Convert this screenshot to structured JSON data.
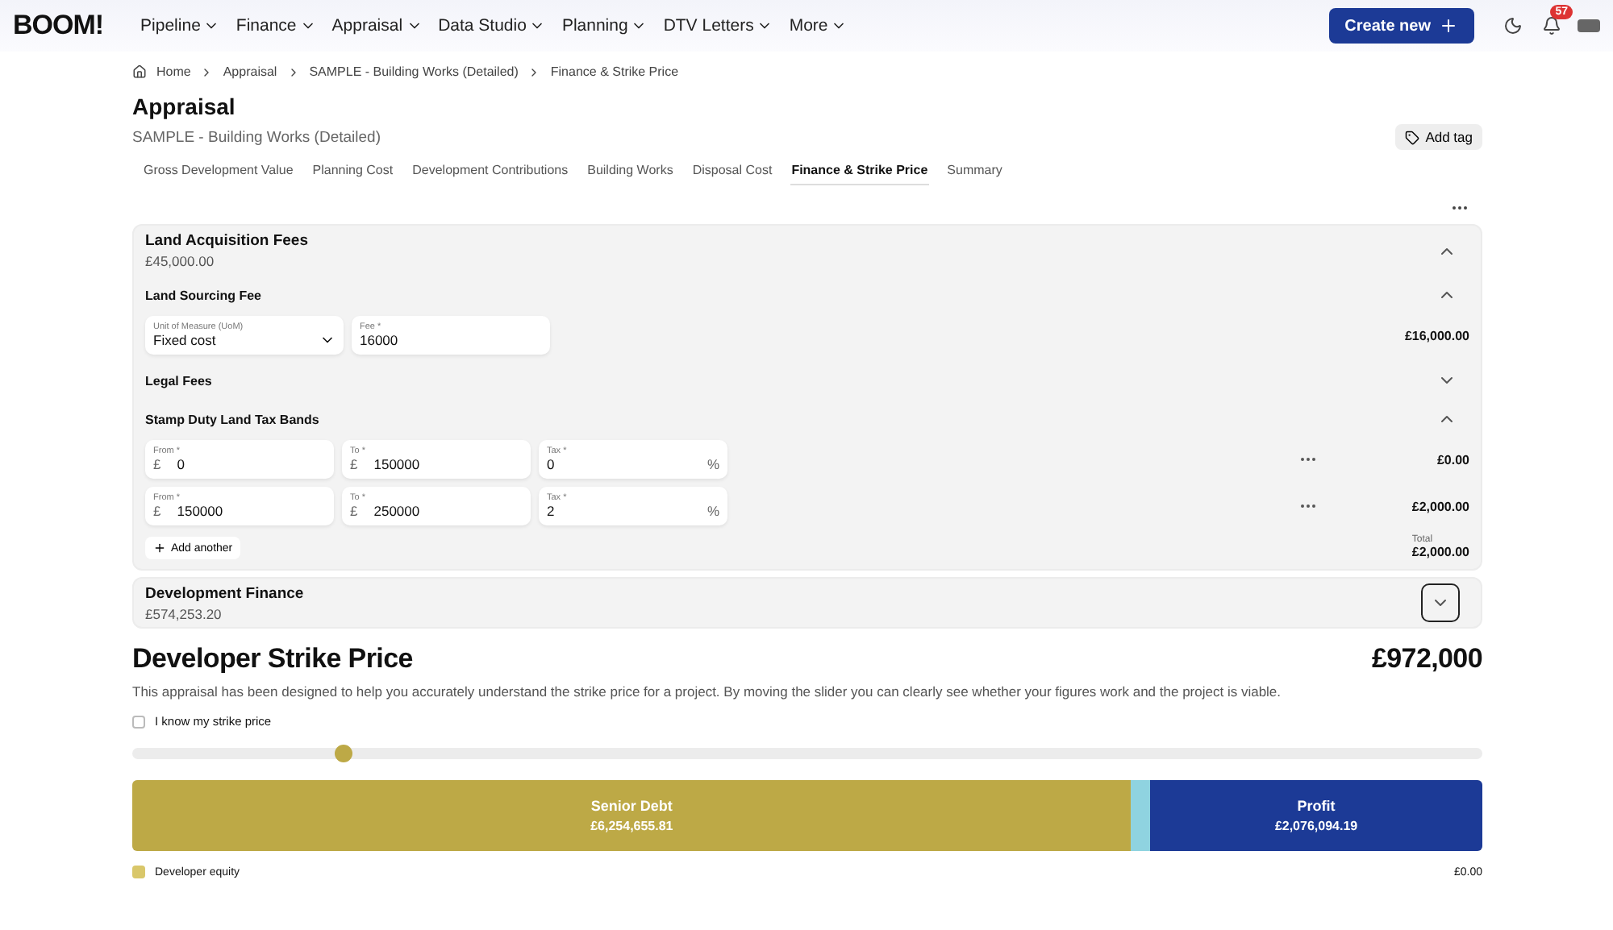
{
  "nav": {
    "logo": "BOOM!",
    "menus": [
      {
        "label": "Pipeline"
      },
      {
        "label": "Finance"
      },
      {
        "label": "Appraisal"
      },
      {
        "label": "Data Studio"
      },
      {
        "label": "Planning"
      },
      {
        "label": "DTV Letters"
      },
      {
        "label": "More"
      }
    ],
    "create_button": "Create new",
    "notification_count": "57"
  },
  "breadcrumbs": [
    "Home",
    "Appraisal",
    "SAMPLE - Building Works (Detailed)",
    "Finance & Strike Price"
  ],
  "page": {
    "title": "Appraisal",
    "subtitle": "SAMPLE - Building Works (Detailed)",
    "tag_button": "Add tag"
  },
  "tabs": [
    {
      "label": "Gross Development Value",
      "selected": false
    },
    {
      "label": "Planning Cost",
      "selected": false
    },
    {
      "label": "Development Contributions",
      "selected": false
    },
    {
      "label": "Building Works",
      "selected": false
    },
    {
      "label": "Disposal Cost",
      "selected": false
    },
    {
      "label": "Finance & Strike Price",
      "selected": true
    },
    {
      "label": "Summary",
      "selected": false
    }
  ],
  "land_acquisition": {
    "title": "Land Acquisition Fees",
    "amount": "£45,000.00",
    "expanded": true,
    "sections": [
      {
        "title": "Land Sourcing Fee",
        "expanded": true,
        "rows": [
          {
            "fields": [
              {
                "kind": "select",
                "label": "Unit of Measure (UoM)",
                "value": "Fixed cost"
              },
              {
                "kind": "text",
                "label": "Fee *",
                "value": "16000"
              }
            ],
            "menu": false,
            "amount": "£16,000.00"
          }
        ]
      },
      {
        "title": "Legal Fees",
        "expanded": false
      },
      {
        "title": "Stamp Duty Land Tax Bands",
        "expanded": true,
        "rows": [
          {
            "fields": [
              {
                "kind": "text",
                "label": "From *",
                "prefix": "£",
                "value": "0"
              },
              {
                "kind": "text",
                "label": "To *",
                "prefix": "£",
                "value": "150000"
              },
              {
                "kind": "text",
                "label": "Tax *",
                "suffix": "%",
                "value": "0"
              }
            ],
            "menu": true,
            "amount": "£0.00"
          },
          {
            "fields": [
              {
                "kind": "text",
                "label": "From *",
                "prefix": "£",
                "value": "150000"
              },
              {
                "kind": "text",
                "label": "To *",
                "prefix": "£",
                "value": "250000"
              },
              {
                "kind": "text",
                "label": "Tax *",
                "suffix": "%",
                "value": "2"
              }
            ],
            "menu": true,
            "amount": "£2,000.00"
          }
        ],
        "add_button": "Add another",
        "total_label": "Total",
        "total": "£2,000.00"
      }
    ]
  },
  "development_finance": {
    "title": "Development Finance",
    "amount": "£574,253.20",
    "expanded": false,
    "focused": true
  },
  "strike_price": {
    "title": "Developer Strike Price",
    "value": "£972,000",
    "description": "This appraisal has been designed to help you accurately understand the strike price for a project. By moving the slider you can clearly see whether your figures work and the project is viable.",
    "checkbox": {
      "label": "I know my strike price",
      "checked": false
    },
    "slider": {
      "level": 0.157
    },
    "segments": [
      {
        "label": "Senior Debt",
        "amount": "£6,254,655.81",
        "level": 0.74,
        "color": "#bda946"
      },
      {
        "level": 0.014,
        "color": "#8fd3e0"
      },
      {
        "label": "Profit",
        "amount": "£2,076,094.19",
        "level": 0.246,
        "color": "#1c3a96"
      }
    ],
    "legend": [
      {
        "label": "Developer equity",
        "amount": "£0.00",
        "color": "#d9c76a"
      }
    ]
  }
}
